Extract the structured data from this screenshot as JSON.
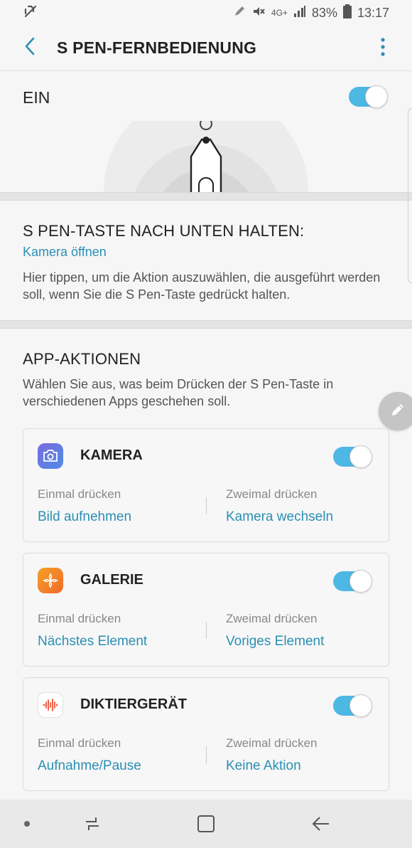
{
  "status_bar": {
    "network_label": "4G+",
    "battery": "83%",
    "time": "13:17",
    "icons": [
      "no-sim-icon",
      "pen-icon",
      "mute-icon",
      "signal-icon",
      "battery-icon"
    ]
  },
  "app_bar": {
    "title": "S PEN-FERNBEDIENUNG",
    "icons": [
      "back-arrow-icon",
      "more-vert-icon"
    ]
  },
  "master_switch": {
    "label": "EIN",
    "on": true
  },
  "hold_action": {
    "title": "S PEN-TASTE NACH UNTEN HALTEN:",
    "action": "Kamera öffnen",
    "description": "Hier tippen, um die Aktion auszuwählen, die ausgeführt werden soll, wenn Sie die S Pen-Taste gedrückt halten."
  },
  "app_actions": {
    "title": "APP-AKTIONEN",
    "description": "Wählen Sie aus, was beim Drücken der S Pen-Taste in verschiedenen Apps geschehen soll.",
    "cards": [
      {
        "name": "KAMERA",
        "icon": "camera-app-icon",
        "enabled": true,
        "once_label": "Einmal drücken",
        "once_value": "Bild aufnehmen",
        "twice_label": "Zweimal drücken",
        "twice_value": "Kamera wechseln"
      },
      {
        "name": "GALERIE",
        "icon": "gallery-app-icon",
        "enabled": true,
        "once_label": "Einmal drücken",
        "once_value": "Nächstes Element",
        "twice_label": "Zweimal drücken",
        "twice_value": "Voriges Element"
      },
      {
        "name": "DIKTIERGERÄT",
        "icon": "voice-recorder-app-icon",
        "enabled": true,
        "once_label": "Einmal drücken",
        "once_value": "Aufnahme/Pause",
        "twice_label": "Zweimal drücken",
        "twice_value": "Keine Aktion"
      }
    ]
  },
  "nav_bar": {
    "icons": [
      "dot-icon",
      "recents-icon",
      "home-icon",
      "back-icon"
    ]
  },
  "colors": {
    "accent": "#2a8fb4",
    "toggle_on": "#4db8e3",
    "background": "#f6f6f6"
  }
}
